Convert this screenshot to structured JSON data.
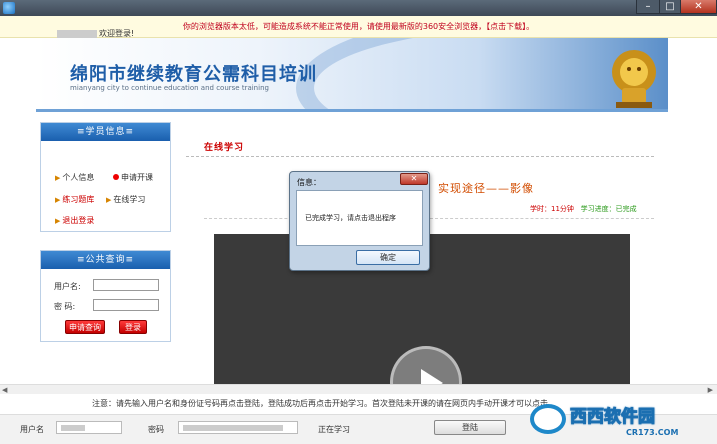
{
  "titlebar": {
    "min": "–",
    "max": "□",
    "close": "✕"
  },
  "warning": "你的浏览器版本太低，可能造成系统不能正常使用，请使用最新版的360安全浏览器，【点击下载】。",
  "header": {
    "title": "绵阳市继续教育公需科目培训",
    "subtitle": "mianyang city to continue education and course training"
  },
  "student_panel": {
    "title": "≡学员信息≡",
    "welcome": "欢迎登录!",
    "items": [
      "个人信息",
      "申请开课",
      "练习题库",
      "在线学习",
      "退出登录"
    ]
  },
  "query_panel": {
    "title": "≡公共查询≡",
    "username_label": "用户名:",
    "password_label": "密  码:",
    "apply_btn": "申请查询",
    "login_btn": "登录"
  },
  "main": {
    "section_title": "在线学习",
    "course_title": "实现途径——影像",
    "duration_label": "学时：11分钟",
    "progress_label": "学习进度：已完成"
  },
  "notice": "注意：请先输入用户名和身份证号码再点击登陆，登陆成功后再点击开始学习。首次登陆未开课的请在网页内手动开课才可以点击",
  "statusbar": {
    "user_label": "用户名",
    "pass_label": "密码",
    "status": "正在学习",
    "login_btn": "登陆"
  },
  "watermark": {
    "brand": "西西软件园",
    "url": "CR173.COM"
  },
  "dialog": {
    "title": "信息：",
    "message": "已完成学习，请点击退出程序",
    "ok": "确定",
    "close": "✕"
  }
}
